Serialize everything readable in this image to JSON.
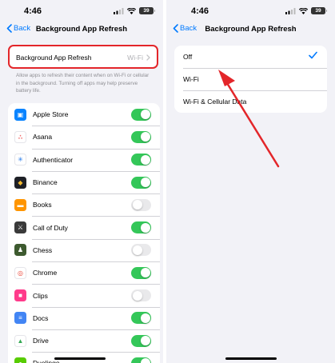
{
  "status": {
    "time": "4:46",
    "battery": "39"
  },
  "nav": {
    "back_label": "Back",
    "title": "Background App Refresh"
  },
  "left": {
    "setting": {
      "label": "Background App Refresh",
      "value": "Wi-Fi"
    },
    "footnote": "Allow apps to refresh their content when on Wi-Fi or cellular in the background. Turning off apps may help preserve battery life.",
    "apps": [
      {
        "name": "Apple Store",
        "on": true,
        "icon": "apple-store-icon",
        "color": "#0a84ff"
      },
      {
        "name": "Asana",
        "on": true,
        "icon": "asana-icon",
        "color": "#f06a6a"
      },
      {
        "name": "Authenticator",
        "on": true,
        "icon": "authenticator-icon",
        "color": "#ffffff"
      },
      {
        "name": "Binance",
        "on": true,
        "icon": "binance-icon",
        "color": "#1e2026"
      },
      {
        "name": "Books",
        "on": false,
        "icon": "books-icon",
        "color": "#ff9500"
      },
      {
        "name": "Call of Duty",
        "on": true,
        "icon": "call-of-duty-icon",
        "color": "#3a3a3a"
      },
      {
        "name": "Chess",
        "on": false,
        "icon": "chess-icon",
        "color": "#3d5a2f"
      },
      {
        "name": "Chrome",
        "on": true,
        "icon": "chrome-icon",
        "color": "#ffffff"
      },
      {
        "name": "Clips",
        "on": false,
        "icon": "clips-icon",
        "color": "#ff3b8b"
      },
      {
        "name": "Docs",
        "on": true,
        "icon": "docs-icon",
        "color": "#4285f4"
      },
      {
        "name": "Drive",
        "on": true,
        "icon": "drive-icon",
        "color": "#ffffff"
      },
      {
        "name": "Duolingo",
        "on": true,
        "icon": "duolingo-icon",
        "color": "#58cc02"
      }
    ]
  },
  "right": {
    "options": [
      {
        "label": "Off",
        "selected": true
      },
      {
        "label": "Wi-Fi",
        "selected": false
      },
      {
        "label": "Wi-Fi & Cellular Data",
        "selected": false
      }
    ]
  },
  "colors": {
    "accent": "#007aff",
    "toggle_on": "#34c759",
    "highlight": "#e3262a"
  }
}
